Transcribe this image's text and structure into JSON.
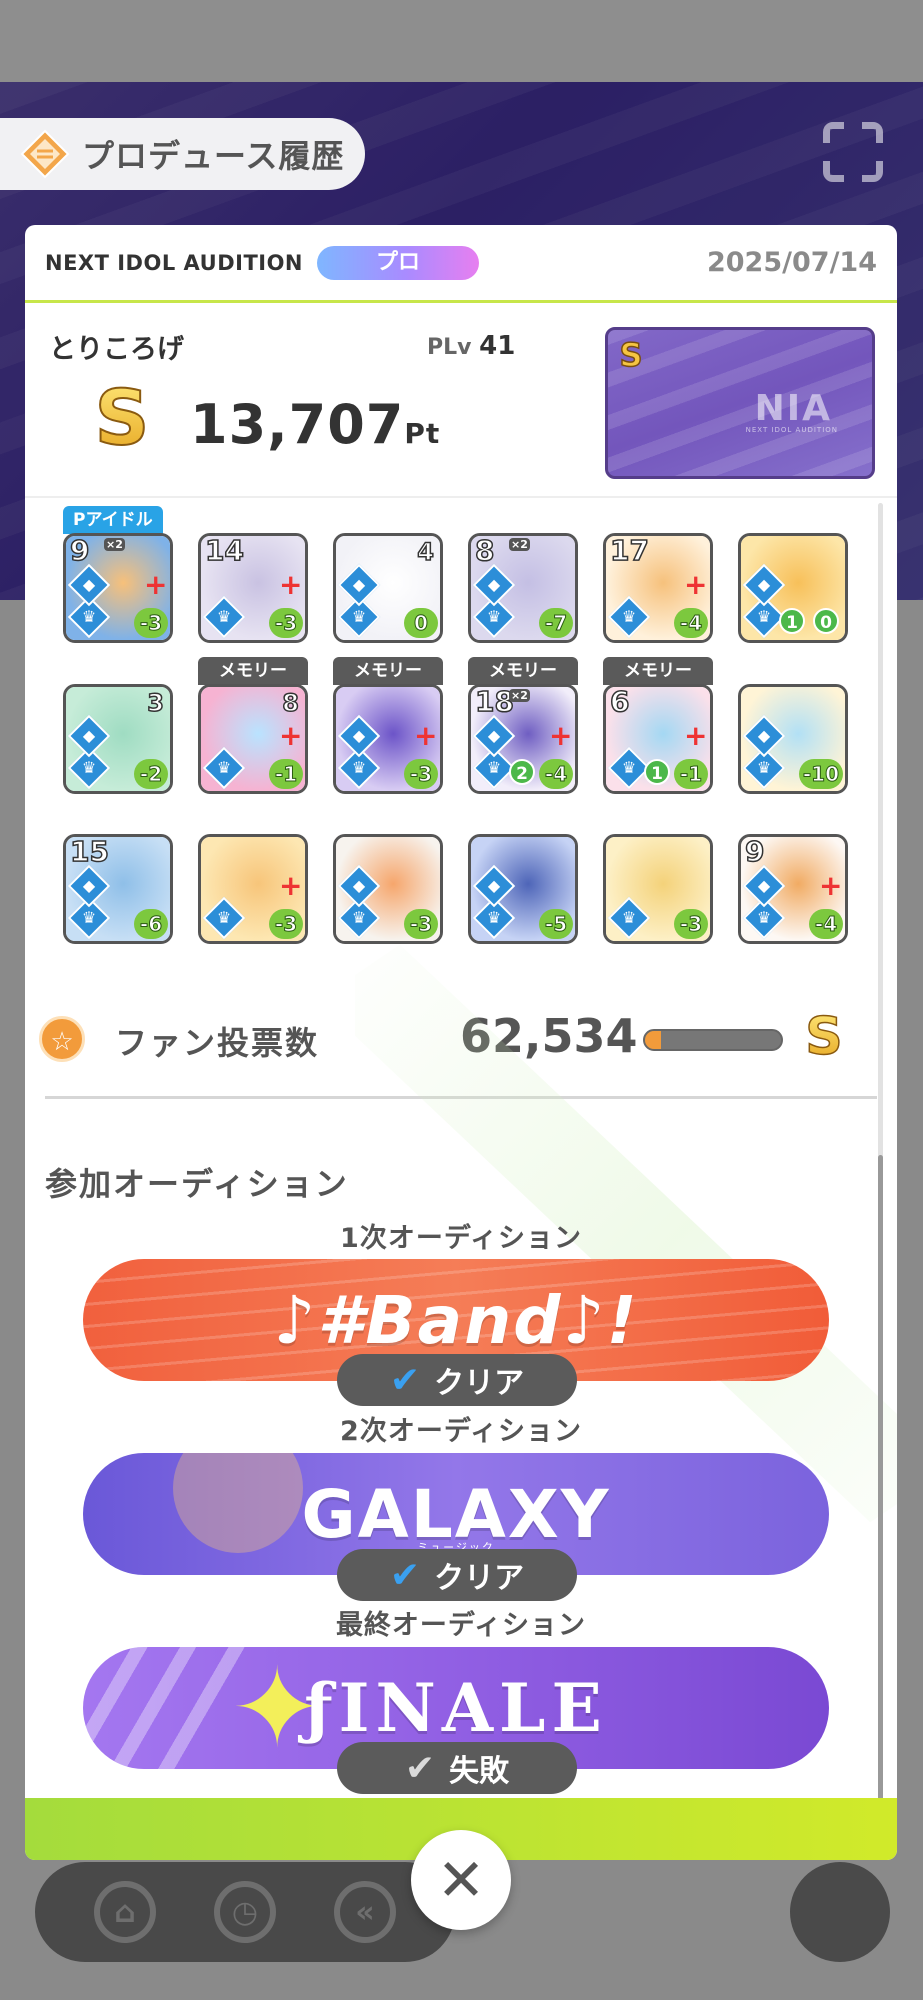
{
  "title": "プロデュース履歴",
  "header": {
    "audition_name": "NEXT IDOL AUDITION",
    "difficulty": "プロ",
    "date": "2025/07/14"
  },
  "summary": {
    "player_name": "とりころげ",
    "plv_label": "PLv",
    "plv_value": "41",
    "rank": "S",
    "score": "13,707",
    "score_unit": "Pt",
    "card_logo": "NIA",
    "card_logo_sub": "NEXT IDOL AUDITION",
    "card_rank": "S"
  },
  "cards": [
    {
      "level": "9",
      "x2": "×2",
      "tag": "Pアイドル",
      "cost": "-3",
      "plus": true
    },
    {
      "level": "14",
      "cost": "-3",
      "plus": true
    },
    {
      "count": "4",
      "cost": "0"
    },
    {
      "level": "8",
      "x2": "×2",
      "cost": "-7"
    },
    {
      "level": "17",
      "cost": "-4",
      "plus": true
    },
    {
      "badge1": "1",
      "badge2": "0"
    },
    {
      "count": "3",
      "cost": "-2"
    },
    {
      "count": "8",
      "tag": "メモリー",
      "cost": "-1",
      "plus": true
    },
    {
      "tag": "メモリー",
      "cost": "-3",
      "plus": true
    },
    {
      "level": "18",
      "x2": "×2",
      "tag": "メモリー",
      "badge1": "2",
      "cost": "-4",
      "plus": true
    },
    {
      "level": "6",
      "tag": "メモリー",
      "badge1": "1",
      "cost": "-1",
      "plus": true
    },
    {
      "cost": "-10"
    },
    {
      "level": "15",
      "cost": "-6"
    },
    {
      "cost": "-3",
      "plus": true
    },
    {
      "cost": "-3"
    },
    {
      "cost": "-5"
    },
    {
      "cost": "-3"
    },
    {
      "level": "9",
      "cost": "-4",
      "plus": true
    }
  ],
  "fan_votes": {
    "label": "ファン投票数",
    "value": "62,534",
    "progress_percent": 12,
    "rank": "S"
  },
  "auditions": {
    "heading": "参加オーディション",
    "stages": [
      {
        "label": "1次オーディション",
        "logo": "♪#Band♪!",
        "result": "クリア",
        "cleared": true
      },
      {
        "label": "2次オーディション",
        "logo": "GALAXY",
        "logo_sub": "ミュージック",
        "result": "クリア",
        "cleared": true
      },
      {
        "label": "最終オーディション",
        "logo": "ƒINALE",
        "result": "失敗",
        "cleared": false
      }
    ]
  },
  "colors": {
    "accent_green": "#a4dc3c",
    "score_orange": "#f29b3b",
    "band_red": "#f1603d",
    "galaxy_purple": "#7b63dd",
    "finale_purple": "#8f5de2"
  },
  "icons": {
    "title": "produce-history-icon",
    "close": "close-icon",
    "fan": "star-icon",
    "result_clear": "check-icon"
  }
}
